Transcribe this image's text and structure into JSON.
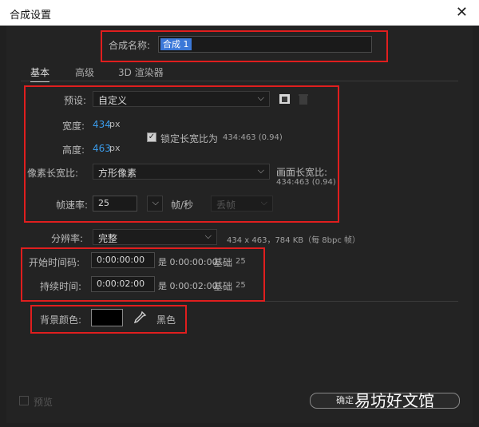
{
  "window": {
    "title": "合成设置",
    "close_glyph": "✕"
  },
  "comp_name": {
    "label": "合成名称:",
    "value": "合成 1"
  },
  "tabs": [
    {
      "label": "基本",
      "active": true
    },
    {
      "label": "高级",
      "active": false
    },
    {
      "label": "3D 渲染器",
      "active": false
    }
  ],
  "preset": {
    "label": "预设:",
    "value": "自定义",
    "icons": [
      "save-preset-icon",
      "delete-preset-icon"
    ]
  },
  "width": {
    "label": "宽度:",
    "value": "434",
    "unit": "px"
  },
  "height": {
    "label": "高度:",
    "value": "463",
    "unit": "px"
  },
  "lock_ratio": {
    "checked": true,
    "label": "锁定长宽比为",
    "ratio": "434:463 (0.94)"
  },
  "pixel_aspect": {
    "label": "像素长宽比:",
    "value": "方形像素"
  },
  "frame_aspect": {
    "label": "画面长宽比:",
    "value": "434:463 (0.94)"
  },
  "frame_rate": {
    "label": "帧速率:",
    "value": "25",
    "unit": "帧/秒",
    "drop_frame": "丢帧"
  },
  "resolution": {
    "label": "分辨率:",
    "value": "完整",
    "info": "434 x 463，784 KB（每 8bpc 帧）"
  },
  "start_timecode": {
    "label": "开始时间码:",
    "value": "0:00:00:00",
    "equals": "是 0:00:00:00",
    "base_label": "基础",
    "base_value": "25"
  },
  "duration": {
    "label": "持续时间:",
    "value": "0:00:02:00",
    "equals": "是 0:00:02:00",
    "base_label": "基础",
    "base_value": "25"
  },
  "background": {
    "label": "背景颜色:",
    "color_name": "黑色",
    "swatch": "#000000",
    "icon": "eyedropper-icon"
  },
  "footer": {
    "preview_label": "预览",
    "ok_label": "确定",
    "watermark": "易坊好文馆"
  },
  "colors": {
    "accent_blue": "#3a9ae8",
    "highlight_red": "#e01e1e",
    "selection": "#3b78d8"
  }
}
